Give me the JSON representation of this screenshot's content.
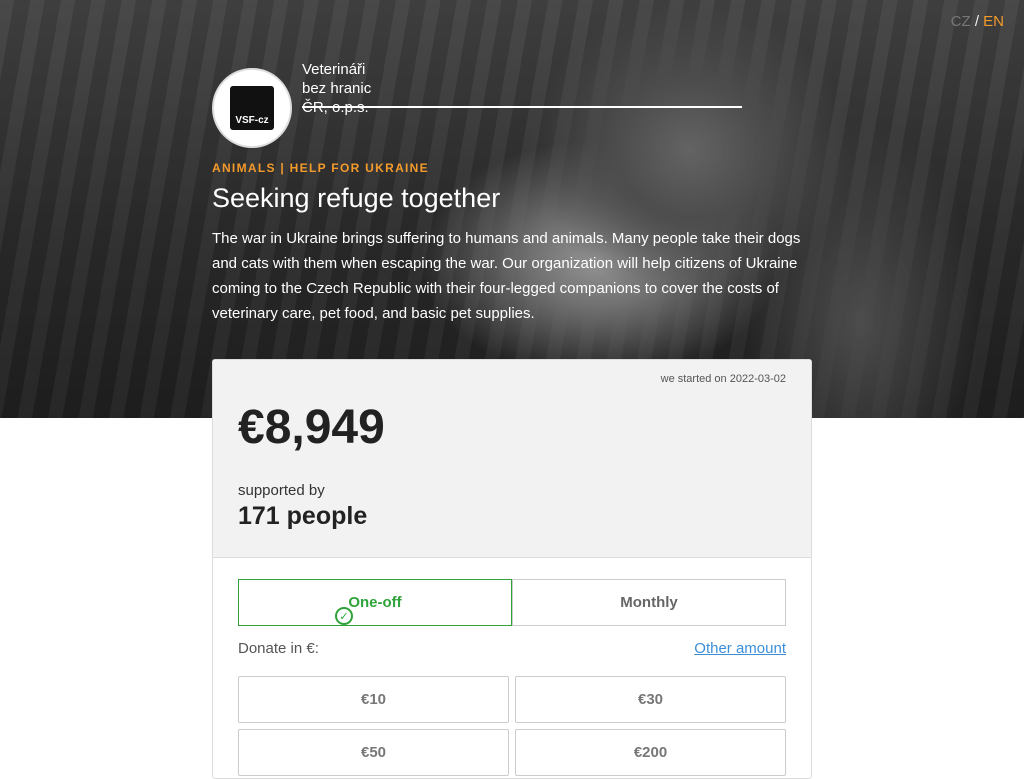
{
  "header": {
    "lang_cz": "CZ",
    "lang_sep": "/",
    "lang_en": "EN",
    "logo_text": "VSF-cz",
    "org_name": "Veterináři bez hranic ČR, o.p.s."
  },
  "campaign": {
    "category": "ANIMALS | HELP FOR UKRAINE",
    "title": "Seeking refuge together",
    "description": "The war in Ukraine brings suffering to humans and animals. Many people take their dogs and cats with them when escaping the war. Our organization will help citizens of Ukraine coming to the Czech Republic with their four-legged companions to cover the costs of veterinary care, pet food, and basic pet supplies."
  },
  "stats": {
    "started": "we started on 2022-03-02",
    "amount": "€8,949",
    "supported_label": "supported by",
    "supporters": "171 people"
  },
  "donation": {
    "one_off": "One-off",
    "monthly": "Monthly",
    "donate_in": "Donate in €:",
    "other_amount": "Other amount",
    "amounts": [
      "€10",
      "€30",
      "€50",
      "€200"
    ],
    "selected_frequency": "One-off"
  },
  "colors": {
    "accent": "#f39a2c",
    "success": "#2fa33a",
    "link": "#3b8fd8"
  }
}
